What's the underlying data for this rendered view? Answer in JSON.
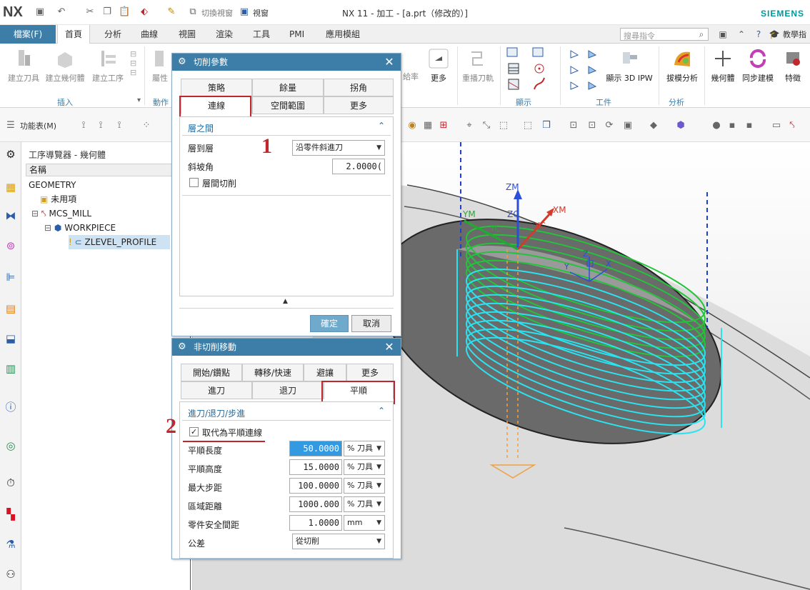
{
  "window": {
    "logo": "NX",
    "title": "NX 11 - 加工 - [a.prt（修改的）]",
    "brand": "SIEMENS",
    "qat_switch": "切換視窗",
    "qat_window": "視窗"
  },
  "ribbon": {
    "file_tab": "檔案(F)",
    "tabs": [
      "首頁",
      "分析",
      "曲線",
      "視圖",
      "渲染",
      "工具",
      "PMI",
      "應用模組"
    ],
    "search_placeholder": "搜尋指令",
    "teach": "教學指",
    "buttons": {
      "create_tool": "建立刀具",
      "create_geometry": "建立幾何體",
      "create_operation": "建立工序",
      "more": "更多",
      "replay": "重播刀軌",
      "show_3d_ipw": "顯示 3D IPW",
      "draft_analysis": "拔模分析",
      "geometry": "幾何體",
      "sync_model": "同步建模",
      "feature": "特徵",
      "rate": "給率",
      "attr": "屬性"
    },
    "groups": {
      "insert": "插入",
      "action": "動作",
      "display": "顯示",
      "workpiece": "工件",
      "analysis": "分析"
    }
  },
  "toolbar2": {
    "menu_label": "功能表(M)"
  },
  "navigator": {
    "title": "工序導覽器 - 幾何體",
    "column": "名稱",
    "rows": [
      "GEOMETRY",
      "未用項",
      "MCS_MILL",
      "WORKPIECE",
      "ZLEVEL_PROFILE"
    ]
  },
  "dialog_cut": {
    "title": "切削參數",
    "tabs_row1": [
      "策略",
      "餘量",
      "拐角"
    ],
    "tabs_row2": [
      "連線",
      "空間範圍",
      "更多"
    ],
    "section": "層之間",
    "layer_to_layer_label": "層到層",
    "layer_to_layer_value": "沿零件斜進刀",
    "ramp_angle_label": "斜坡角",
    "ramp_angle_value": "2.0000(",
    "between_layers_label": "層間切削",
    "ok": "確定",
    "cancel": "取消"
  },
  "dialog_noncut": {
    "title": "非切削移動",
    "tabs_row1": [
      "開始/鑽點",
      "轉移/快速",
      "避讓",
      "更多"
    ],
    "tabs_row2": [
      "進刀",
      "退刀",
      "平順"
    ],
    "section": "進刀/退刀/步進",
    "replace_label": "取代為平順連線",
    "rows": [
      {
        "label": "平順長度",
        "value": "50.0000",
        "unit": "% 刀具"
      },
      {
        "label": "平順高度",
        "value": "15.0000",
        "unit": "% 刀具"
      },
      {
        "label": "最大步距",
        "value": "100.0000",
        "unit": "% 刀具"
      },
      {
        "label": "區域距離",
        "value": "1000.000",
        "unit": "% 刀具"
      },
      {
        "label": "零件安全間距",
        "value": "1.0000",
        "unit": "mm"
      }
    ],
    "tolerance_label": "公差",
    "tolerance_value": "從切削"
  },
  "annotations": {
    "one": "1",
    "two": "2"
  },
  "viewport": {
    "axis_zm": "ZM",
    "axis_zc": "ZC",
    "axis_ym": "YM",
    "axis_yc": "YC",
    "axis_xm": "XM",
    "axis_xc": "XC",
    "axis_z": "Z",
    "axis_y": "Y",
    "axis_x": "X"
  },
  "colors": {
    "accent": "#3c7ea8",
    "highlight": "#c0272d",
    "toolpath_cyan": "#29e3f0",
    "toolpath_green": "#22c43a",
    "engage_orange": "#f0a040"
  }
}
